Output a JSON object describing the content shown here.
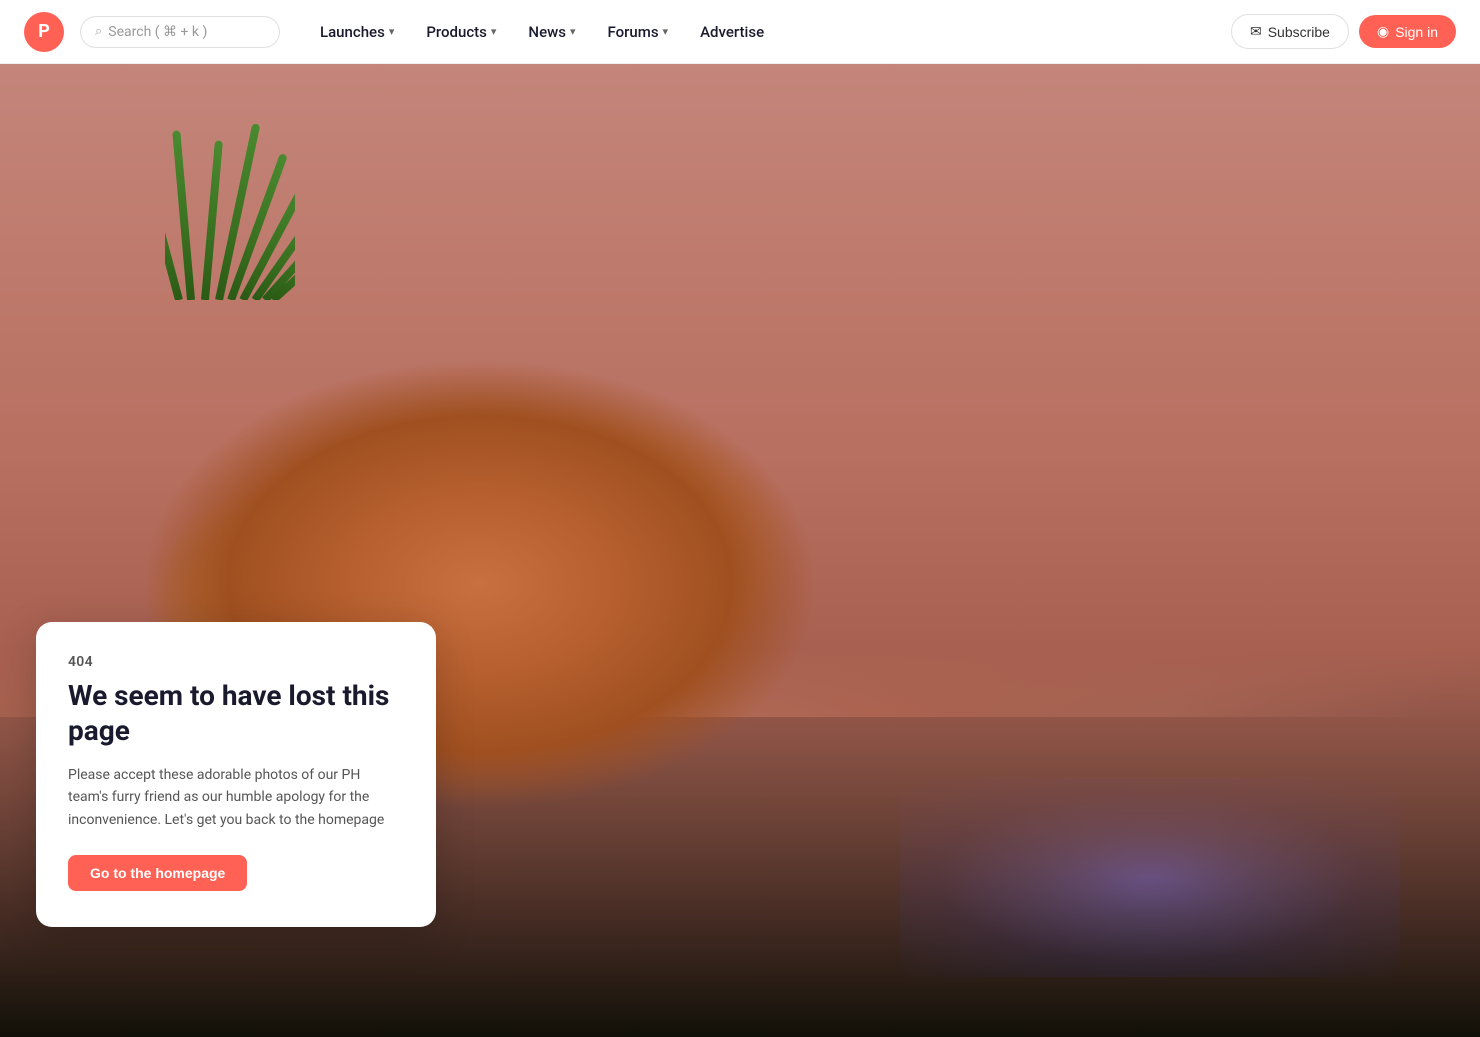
{
  "brand": {
    "logo_letter": "P",
    "logo_bg": "#FF6154"
  },
  "navbar": {
    "search_placeholder": "Search ( ⌘ + k )",
    "links": [
      {
        "label": "Launches",
        "has_dropdown": true
      },
      {
        "label": "Products",
        "has_dropdown": true
      },
      {
        "label": "News",
        "has_dropdown": true
      },
      {
        "label": "Forums",
        "has_dropdown": true
      },
      {
        "label": "Advertise",
        "has_dropdown": false
      }
    ],
    "subscribe_label": "Subscribe",
    "signin_label": "Sign in"
  },
  "error_page": {
    "code": "404",
    "title": "We seem to have lost this page",
    "description": "Please accept these adorable photos of our PH team's furry friend as our humble apology for the inconvenience. Let's get you back to the homepage",
    "cta_label": "Go to the homepage"
  }
}
